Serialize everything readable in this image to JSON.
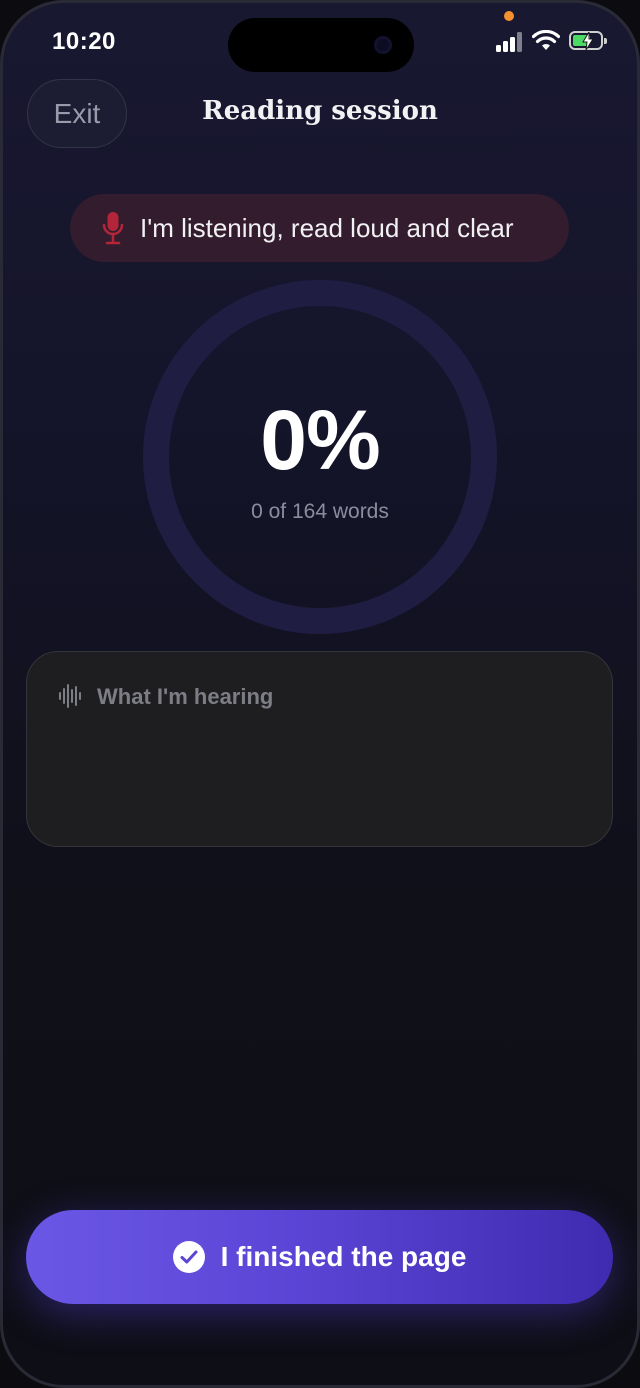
{
  "status_bar": {
    "time": "10:20",
    "icons": [
      "signal-icon",
      "wifi-icon",
      "battery-charging-icon"
    ],
    "battery_color": "#4cd964",
    "privacy_dot_color": "#f5922f"
  },
  "header": {
    "exit_label": "Exit",
    "title": "Reading session"
  },
  "listening": {
    "icon": "microphone-icon",
    "text": "I'm listening, read loud and clear",
    "icon_color": "#b3263a"
  },
  "progress": {
    "percent_label": "0%",
    "percent": 0,
    "words_label": "0 of 164 words",
    "ring_color": "#201d42"
  },
  "hearing": {
    "icon": "waveform-icon",
    "label": "What I'm hearing"
  },
  "finish": {
    "icon": "checkmark-circle-icon",
    "label": "I finished the page",
    "accent": "#5b45d6"
  }
}
